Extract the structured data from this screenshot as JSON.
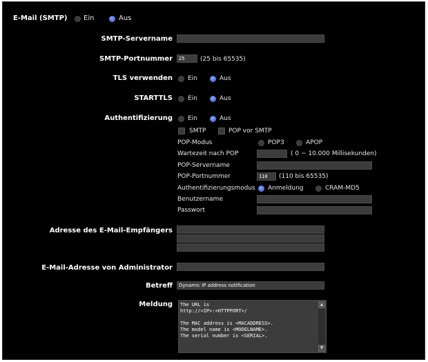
{
  "header": {
    "title": "E-Mail (SMTP)",
    "on_label": "Ein",
    "off_label": "Aus"
  },
  "smtp_server": {
    "label": "SMTP-Servername",
    "value": ""
  },
  "smtp_port": {
    "label": "SMTP-Portnummer",
    "value": "25",
    "hint": "(25 bis 65535)"
  },
  "tls": {
    "label": "TLS verwenden",
    "on_label": "Ein",
    "off_label": "Aus"
  },
  "starttls": {
    "label": "STARTTLS",
    "on_label": "Ein",
    "off_label": "Aus"
  },
  "auth": {
    "label": "Authentifizierung",
    "on_label": "Ein",
    "off_label": "Aus",
    "smtp_label": "SMTP",
    "pop_before_smtp_label": "POP vor SMTP",
    "pop_mode_label": "POP-Modus",
    "pop3_label": "POP3",
    "apop_label": "APOP",
    "wait_label": "Wartezeit nach POP",
    "wait_value": "",
    "wait_hint": "( 0 ~ 10.000 Millisekunden)",
    "pop_server_label": "POP-Servername",
    "pop_server_value": "",
    "pop_port_label": "POP-Portnummer",
    "pop_port_value": "110",
    "pop_port_hint": "(110 bis 65535)",
    "auth_mode_label": "Authentifizierungsmodus",
    "login_label": "Anmeldung",
    "cram_label": "CRAM-MD5",
    "username_label": "Benutzername",
    "username_value": "",
    "password_label": "Passwort",
    "password_value": ""
  },
  "recipient": {
    "label": "Adresse des E-Mail-Empfängers",
    "values": [
      "",
      "",
      ""
    ]
  },
  "admin": {
    "label": "E-Mail-Adresse von Administrator",
    "value": ""
  },
  "subject": {
    "label": "Betreff",
    "value": "Dynamic IP address notification"
  },
  "message": {
    "label": "Meldung",
    "value": "The URL is\nhttp://<IP>:<HTTPPORT>/\n\nThe MAC address is <MACADDRESS>.\nThe model name is <MODELNAME>.\nThe serial number is <SERIAL>."
  },
  "colors": {
    "background": "#000000",
    "field": "#3c3c3c",
    "radio_selected": "#5573e8"
  }
}
